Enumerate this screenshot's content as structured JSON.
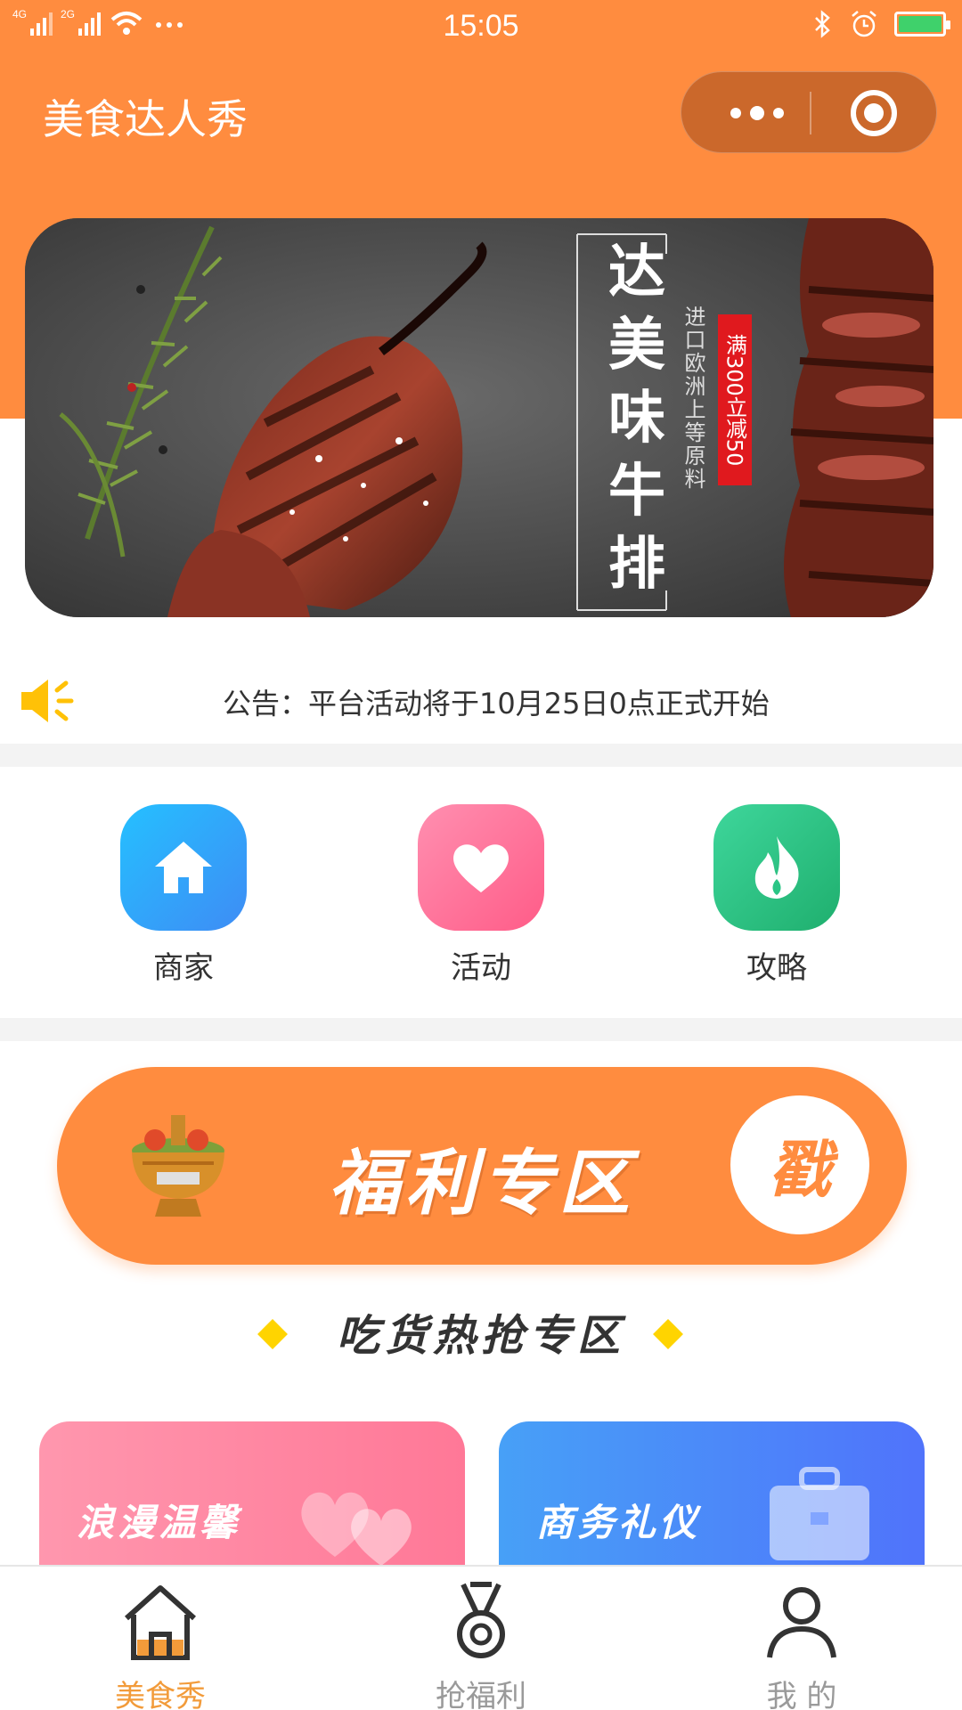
{
  "status_bar": {
    "signal_left": "4G",
    "signal_right": "2G",
    "time": "15:05",
    "icons": [
      "signal-icon",
      "wifi-icon",
      "more-icon",
      "bluetooth-icon",
      "alarm-icon",
      "battery-icon"
    ]
  },
  "header": {
    "title": "美食达人秀",
    "capsule": {
      "more_icon": "more-dots-icon",
      "close_icon": "target-icon"
    },
    "color": "#FF8C3F"
  },
  "banner": {
    "title_chars": [
      "达",
      "美",
      "味",
      "牛",
      "排"
    ],
    "subtitle": "进口欧洲上等原料",
    "tag": "满300立减50"
  },
  "notice": {
    "icon": "speaker-icon",
    "text": "公告：平台活动将于10月25日0点正式开始"
  },
  "categories": [
    {
      "label": "商家",
      "icon": "home-icon",
      "color": "#2EAAF7"
    },
    {
      "label": "活动",
      "icon": "heart-icon",
      "color": "#FF6F96"
    },
    {
      "label": "攻略",
      "icon": "fire-icon",
      "color": "#2DC07E"
    }
  ],
  "welfare": {
    "title": "福利专区",
    "stamp": "戳"
  },
  "hot_section": {
    "title": "吃货热抢专区"
  },
  "cards": [
    {
      "title": "浪漫温馨",
      "icon": "hearts-icon"
    },
    {
      "title": "商务礼仪",
      "icon": "briefcase-icon"
    }
  ],
  "tabbar": [
    {
      "label": "美食秀",
      "icon": "home-icon",
      "active": true
    },
    {
      "label": "抢福利",
      "icon": "medal-icon",
      "active": false
    },
    {
      "label": "我 的",
      "icon": "user-icon",
      "active": false
    }
  ],
  "colors": {
    "active_tab": "#F29B3A",
    "inactive_tab": "#9a9a9a"
  }
}
